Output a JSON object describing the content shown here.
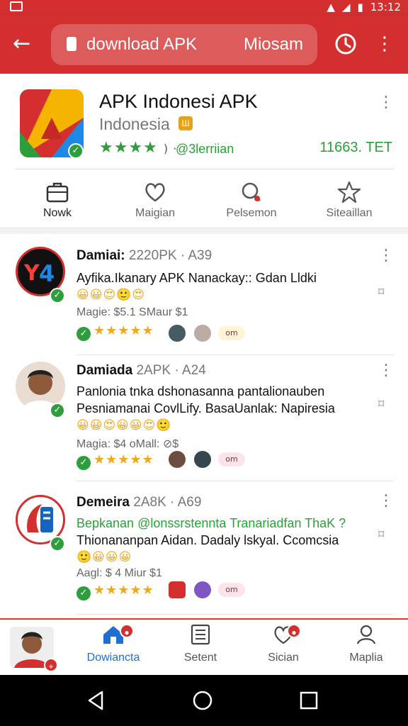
{
  "status_bar": {
    "time": "13:12"
  },
  "app_bar": {
    "url": "download APK",
    "extra_text": "Miosam"
  },
  "app": {
    "title": "APK Indonesi APK",
    "subtitle": "Indonesia",
    "stars": "★★★★",
    "rating_suffix": ") ·",
    "handle": "@3lerriian",
    "count": "11663. TET"
  },
  "actions": [
    {
      "label": "Nowk",
      "icon": "briefcase-icon"
    },
    {
      "label": "Maigian",
      "icon": "heart-icon"
    },
    {
      "label": "Pelsemon",
      "icon": "search-icon"
    },
    {
      "label": "Siteaillan",
      "icon": "star-icon"
    }
  ],
  "posts": [
    {
      "author": "Damiai:",
      "meta": "2220PK · A39",
      "line1": "Ayfika.Ikanary APK Nanackay:: Gdan Lldki",
      "line1_green": false,
      "line2": "",
      "emojis": "😀😀😍🙂😍",
      "price_line": "Magie: $5.1 SMaur  $1",
      "stars": "★★★★★",
      "pill": "om",
      "avatar_color": "#d32f2f",
      "avatar_text": "Y4"
    },
    {
      "author": "Damiada",
      "meta": "2APK · A24",
      "line1": "Panlonia tnka dshonasanna pantalionauben",
      "line1_green": false,
      "line2": "Pesniamanai CovlLify. BasaUanlak: Napiresia",
      "emojis": "😀😀😍😀😀😍🙂",
      "price_line": "Magia: $4 oMall:  ⊘$",
      "stars": "★★★★★",
      "pill": "om",
      "avatar_color": "#8d5a3b",
      "avatar_text": ""
    },
    {
      "author": "Demeira",
      "meta": "2A8K · A69",
      "line1": "Bepkanan @lonssrstennta Tranariadfan ThaK ?",
      "line1_green": true,
      "line2": "Thionananpan Aidan. Dadaly lskyal. Ccomcsia",
      "emojis": "🙂😀😀😀",
      "price_line": "Aagl: $ 4  Miur  $1",
      "stars": "★★★★★",
      "pill": "om",
      "avatar_color": "#1565c0",
      "avatar_text": ""
    }
  ],
  "bottom_nav": [
    {
      "label": "",
      "icon": "profile-avatar"
    },
    {
      "label": "Dowiancta",
      "icon": "home-icon",
      "active": true
    },
    {
      "label": "Setent",
      "icon": "list-icon"
    },
    {
      "label": "Sician",
      "icon": "heart-icon"
    },
    {
      "label": "Maplia",
      "icon": "person-icon"
    }
  ],
  "colors": {
    "brand": "#d32f2f",
    "accent": "#2e9d3b",
    "active": "#1e6fd1"
  }
}
